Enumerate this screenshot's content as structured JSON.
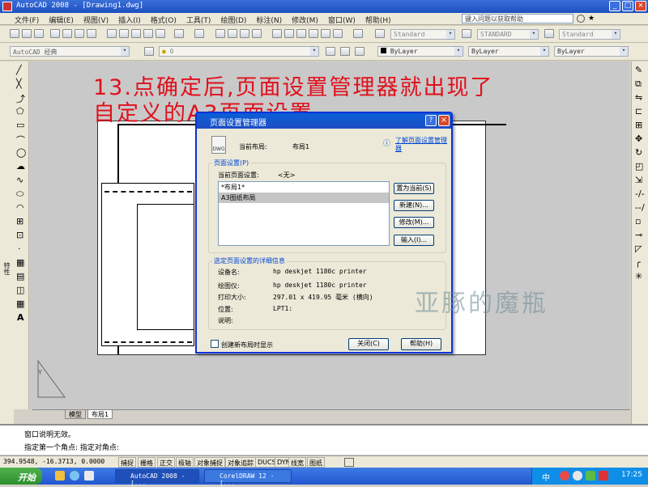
{
  "window": {
    "title": "AutoCAD 2008 - [Drawing1.dwg]",
    "help_placeholder": "键入问题以获取帮助"
  },
  "menu": [
    "文件(F)",
    "编辑(E)",
    "视图(V)",
    "插入(I)",
    "格式(O)",
    "工具(T)",
    "绘图(D)",
    "标注(N)",
    "修改(M)",
    "窗口(W)",
    "帮助(H)"
  ],
  "toolbar": {
    "text_style": "Standard",
    "dim_style": "STANDARD",
    "table_style": "Standard",
    "workspace": "AutoCAD 经典",
    "layer": "0",
    "color": "ByLayer",
    "linetype": "ByLayer",
    "lineweight": "ByLayer"
  },
  "heading": {
    "line1": "13.点确定后,页面设置管理器就出现了",
    "line2": "自定义的A3页面设置."
  },
  "dialog": {
    "title": "页面设置管理器",
    "current_layout_label": "当前布局:",
    "current_layout_value": "布局1",
    "learn_link": "了解页面设置管理器",
    "page_setups_group": "页面设置(P)",
    "current_setup_label": "当前页面设置:",
    "current_setup_value": "<无>",
    "list_items": [
      "*布局1*",
      "A3图纸布局"
    ],
    "btn_set_current": "置为当前(S)",
    "btn_new": "新建(N)...",
    "btn_modify": "修改(M)...",
    "btn_import": "输入(I)...",
    "details_group": "选定页面设置的详细信息",
    "details": [
      {
        "label": "设备名:",
        "value": "hp deskjet 1180c printer"
      },
      {
        "label": "绘图仪:",
        "value": "hp deskjet 1180c printer"
      },
      {
        "label": "打印大小:",
        "value": "297.01 x 419.95 毫米 (横向)"
      },
      {
        "label": "位置:",
        "value": "LPT1:"
      },
      {
        "label": "说明:",
        "value": ""
      }
    ],
    "checkbox_label": "创建新布局时显示",
    "btn_close": "关闭(C)",
    "btn_help": "帮助(H)"
  },
  "tabs": [
    "模型",
    "布局1"
  ],
  "command": {
    "line1": "窗口说明无效。",
    "line2": "指定第一个角点: 指定对角点:"
  },
  "status": {
    "coords": "394.9548, -16.3713, 0.0000",
    "buttons": [
      "捕捉",
      "栅格",
      "正交",
      "极轴",
      "对象捕捉",
      "对象追踪",
      "DUCS",
      "DYN",
      "线宽",
      "图纸"
    ]
  },
  "taskbar": {
    "start": "开始",
    "tasks": [
      "AutoCAD 2008 - [...",
      "CorelDRAW 12 - [..."
    ],
    "time": "17:25",
    "ime": "中"
  },
  "watermark": "亚豚的魔瓶"
}
